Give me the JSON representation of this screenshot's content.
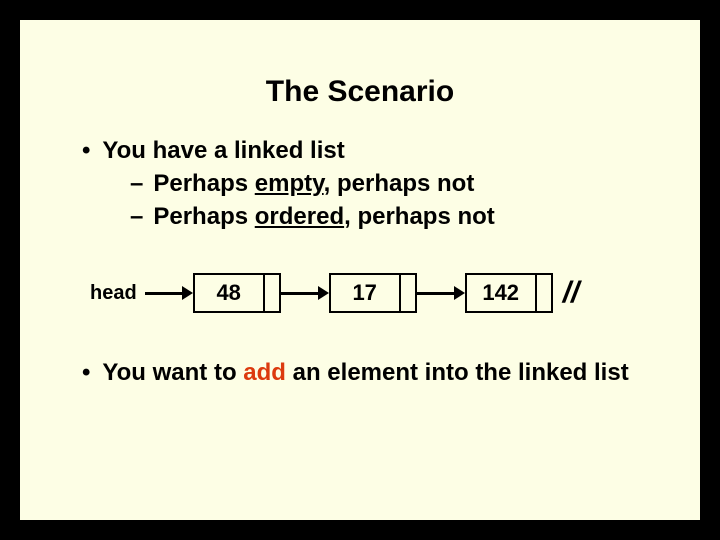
{
  "title": "The Scenario",
  "bullets": {
    "b1": "You have a linked list",
    "b1a_pre": "Perhaps ",
    "b1a_u": "empty",
    "b1a_post": ", perhaps not",
    "b1b_pre": "Perhaps ",
    "b1b_u": "ordered",
    "b1b_post": ", perhaps not",
    "b2_pre": "You want to ",
    "b2_hl": "add",
    "b2_post": " an element into the linked list"
  },
  "diagram": {
    "head_label": "head",
    "nodes": [
      "48",
      "17",
      "142"
    ],
    "terminator": "//"
  }
}
